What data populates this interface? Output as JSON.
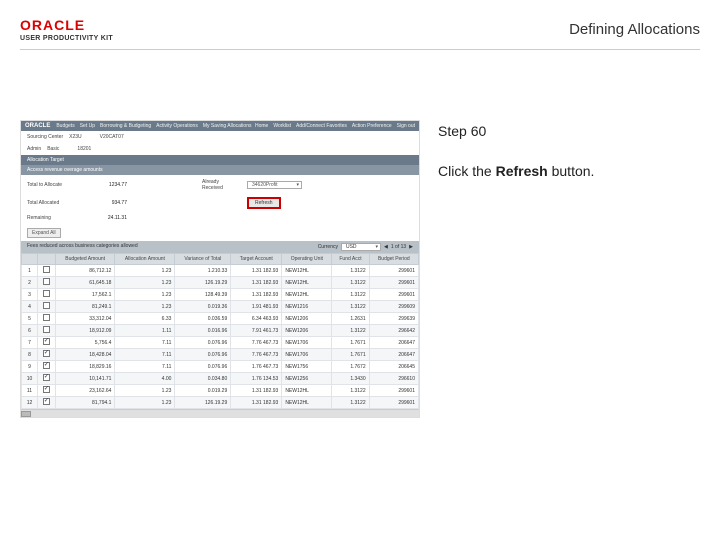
{
  "header": {
    "brand": "ORACLE",
    "subbrand": "USER PRODUCTIVITY KIT",
    "title": "Defining Allocations"
  },
  "instructions": {
    "step_label": "Step 60",
    "pre": "Click the ",
    "bold": "Refresh",
    "post": " button."
  },
  "app": {
    "brand": "ORACLE",
    "nav": [
      "Budgets",
      "Set Up",
      "Borrowing & Budgeting",
      "Activity Operations",
      "My Saving Allocations"
    ],
    "right_nav": [
      "Home",
      "Worklist",
      "Add/Connect Favorites",
      "Action Preference",
      "Sign out"
    ],
    "filters": {
      "center_lbl": "Sourcing Center",
      "center_val": "X23U",
      "period_lbl": "V20CAT07",
      "admin_lbl": "Admin",
      "admin_val": "Basic",
      "code_val": "18201"
    },
    "band1": "Allocation Target",
    "band2": "Access revenue overage amounts",
    "summary": {
      "total_allocate_lbl": "Total to Allocate",
      "total_allocate_val": "1234.77",
      "already_lbl": "Already Received",
      "already_dd": "34620Profit",
      "total_allocated_lbl": "Total Allocated",
      "total_allocated_val": "934.77",
      "remaining_lbl": "Remaining",
      "remaining_val": "24.11.31",
      "refresh_label": "Refresh"
    },
    "expand": "Expand All",
    "gridhead": "Fees reduced across business categories allowed",
    "currency_lbl": "Currency",
    "currency_val": "USD",
    "pager": "1 of 13",
    "columns": [
      "",
      "",
      "Budgeted Amount",
      "Allocation Amount",
      "Variance of Total",
      "Target Account",
      "Operating Unit",
      "Fund Acct",
      "Budget Period"
    ],
    "rows": [
      {
        "n": "1",
        "bud": "86,712.12",
        "alloc": "1.23",
        "var": "1.210.33",
        "tgt": "1.31 182.93",
        "ou": "NEW12HL",
        "fund": "1.3122",
        "per": "299601"
      },
      {
        "n": "2",
        "bud": "61,645.18",
        "alloc": "1.23",
        "var": "126.19.29",
        "tgt": "1.31 182.93",
        "ou": "NEW12HL",
        "fund": "1.3122",
        "per": "299601"
      },
      {
        "n": "3",
        "bud": "17,562.1",
        "alloc": "1.23",
        "var": "128.49.39",
        "tgt": "1.31 182.93",
        "ou": "NEW12HL",
        "fund": "1.3122",
        "per": "299601"
      },
      {
        "n": "4",
        "bud": "81,249.1",
        "alloc": "1.23",
        "var": "0.019.36",
        "tgt": "1.91 481.93",
        "ou": "NEW1216",
        "fund": "1.3122",
        "per": "299609"
      },
      {
        "n": "5",
        "bud": "33,312.04",
        "alloc": "6.33",
        "var": "0.036.59",
        "tgt": "6.34 463.93",
        "ou": "NEW1206",
        "fund": "1.2631",
        "per": "299639"
      },
      {
        "n": "6",
        "bud": "18,912.09",
        "alloc": "1.11",
        "var": "0.016.96",
        "tgt": "7.91 461.73",
        "ou": "NEW1206",
        "fund": "1.3122",
        "per": "296642"
      },
      {
        "n": "7",
        "chk": true,
        "bud": "5,756.4",
        "alloc": "7.11",
        "var": "0.076.96",
        "tgt": "7.76 467.73",
        "ou": "NEW1706",
        "fund": "1.7671",
        "per": "206647"
      },
      {
        "n": "8",
        "chk": true,
        "bud": "18,428.04",
        "alloc": "7.11",
        "var": "0.076.96",
        "tgt": "7.76 467.73",
        "ou": "NEW1706",
        "fund": "1.7671",
        "per": "206647"
      },
      {
        "n": "9",
        "chk": true,
        "bud": "18,829.16",
        "alloc": "7.11",
        "var": "0.076.96",
        "tgt": "1.76 467.73",
        "ou": "NEW1756",
        "fund": "1.7672",
        "per": "206645"
      },
      {
        "n": "10",
        "chk": true,
        "bud": "10,141.71",
        "alloc": "4.00",
        "var": "0.034.80",
        "tgt": "1.76 134.53",
        "ou": "NEW1256",
        "fund": "1.3430",
        "per": "296610"
      },
      {
        "n": "11",
        "chk": true,
        "bud": "23,162.64",
        "alloc": "1.23",
        "var": "0.019.29",
        "tgt": "1.31 182.93",
        "ou": "NEW12HL",
        "fund": "1.3122",
        "per": "299601"
      },
      {
        "n": "12",
        "chk": true,
        "bud": "81,794.1",
        "alloc": "1.23",
        "var": "126.19.29",
        "tgt": "1.31 182.93",
        "ou": "NEW12HL",
        "fund": "1.3122",
        "per": "299601"
      }
    ]
  }
}
